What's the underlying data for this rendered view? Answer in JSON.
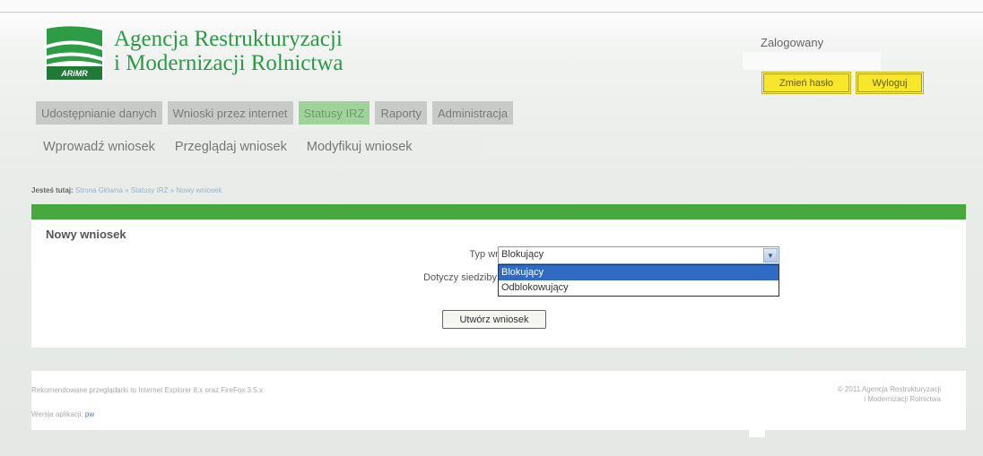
{
  "header": {
    "logo_text": "ARiMR",
    "agency_line1": "Agencja Restrukturyzacji",
    "agency_line2": "i Modernizacji Rolnictwa",
    "logged_in_label": "Zalogowany",
    "change_password": "Zmień hasło",
    "logout": "Wyloguj"
  },
  "main_menu": [
    {
      "label": "Udostępnianie danych",
      "active": false
    },
    {
      "label": "Wnioski przez internet",
      "active": false
    },
    {
      "label": "Statusy IRZ",
      "active": true
    },
    {
      "label": "Raporty",
      "active": false
    },
    {
      "label": "Administracja",
      "active": false
    }
  ],
  "sub_menu": [
    "Wprowadź wniosek",
    "Przeglądaj wniosek",
    "Modyfikuj wniosek"
  ],
  "breadcrumb": {
    "label": "Jesteś tutaj:",
    "path": "Strona Główna » Statusy IRZ » Nowy wniosek"
  },
  "form": {
    "title": "Nowy wniosek",
    "type_label": "Typ wniosku:",
    "type_value": "Blokujący",
    "herd_label": "Dotyczy siedziby stada:",
    "options": [
      "Blokujący",
      "Odblokowujący"
    ],
    "submit": "Utwórz wniosek"
  },
  "footer": {
    "recommended": "Rekomendowane przeglądarki to Internet Explorer 8.x oraz FireFox 3.5.x",
    "version_label": "Wersja aplikacji:",
    "version": "pw",
    "copyright_line1": "© 2011 Agencja Restrukturyzacji",
    "copyright_line2": "i Modernizacji Rolnictwa"
  },
  "colors": {
    "brand_green": "#47a83e",
    "button_yellow": "#f7e62a",
    "selection_blue": "#316ac5"
  }
}
